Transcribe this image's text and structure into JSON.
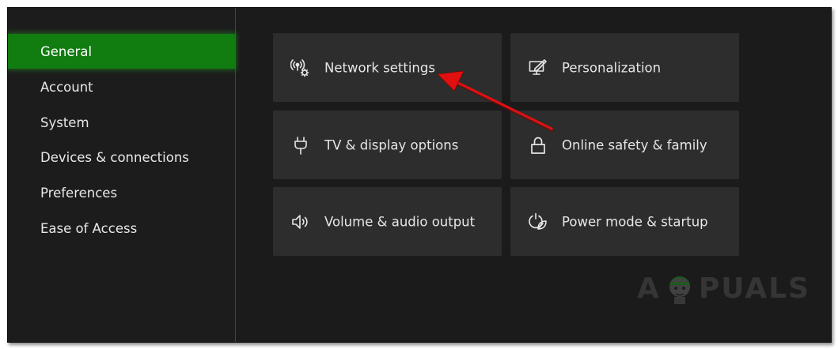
{
  "sidebar": {
    "items": [
      {
        "label": "General",
        "selected": true
      },
      {
        "label": "Account",
        "selected": false
      },
      {
        "label": "System",
        "selected": false
      },
      {
        "label": "Devices & connections",
        "selected": false
      },
      {
        "label": "Preferences",
        "selected": false
      },
      {
        "label": "Ease of Access",
        "selected": false
      }
    ]
  },
  "tiles": [
    {
      "label": "Network settings",
      "icon": "network-settings-icon"
    },
    {
      "label": "Personalization",
      "icon": "personalization-icon"
    },
    {
      "label": "TV & display options",
      "icon": "tv-display-icon"
    },
    {
      "label": "Online safety & family",
      "icon": "lock-icon"
    },
    {
      "label": "Volume & audio output",
      "icon": "speaker-icon"
    },
    {
      "label": "Power mode & startup",
      "icon": "power-leaf-icon"
    }
  ],
  "watermark": {
    "left": "A",
    "right": "PUALS"
  },
  "colors": {
    "accent": "#117c10",
    "background": "#1b1b1b",
    "tile": "#2d2d2d",
    "annotation_arrow": "#e01010"
  }
}
